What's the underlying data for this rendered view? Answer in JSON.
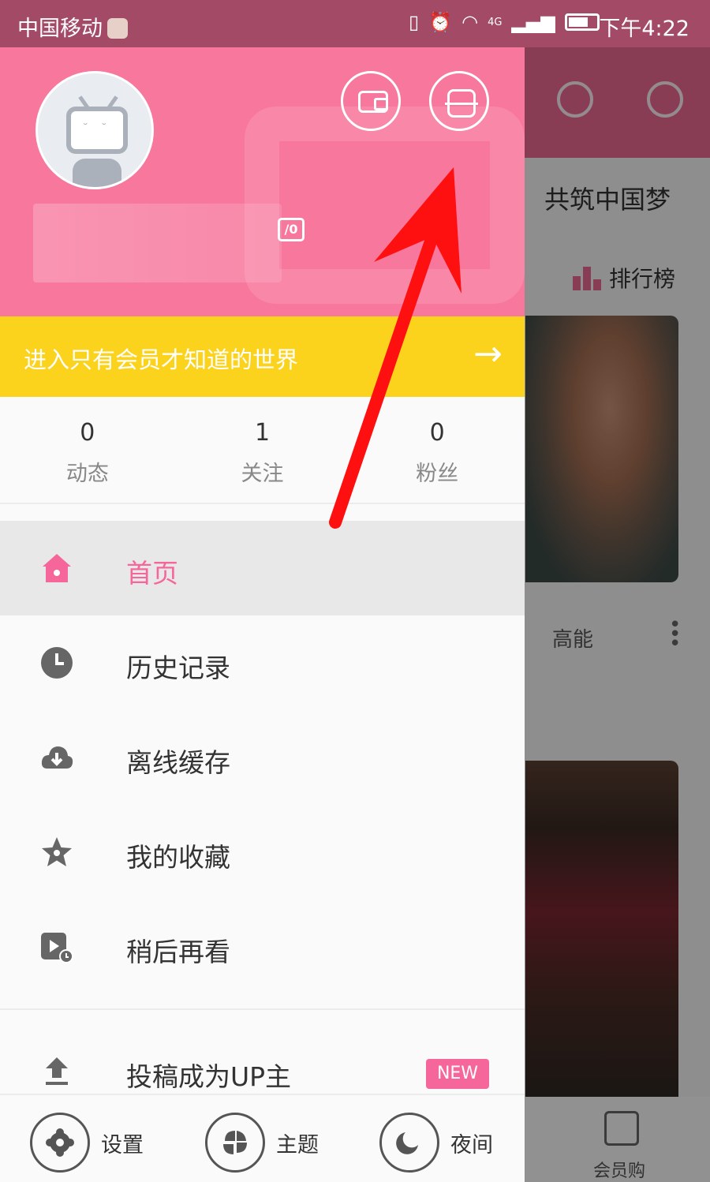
{
  "status_bar": {
    "carrier": "中国移动",
    "network": "4G",
    "time": "下午4:22"
  },
  "background_app": {
    "tab_label": "共筑中国梦",
    "ranking_label": "排行榜",
    "card_tag": "高能",
    "shop_label": "会员购",
    "accent_color": "#ed6a92"
  },
  "drawer": {
    "header": {
      "level_badge": "/0",
      "wallet_icon": "wallet-icon",
      "scan_icon": "scan-icon",
      "color": "#f7779d"
    },
    "vip_banner": {
      "text": "进入只有会员才知道的世界",
      "arrow": "→",
      "color": "#fcd31c"
    },
    "stats": [
      {
        "value": "0",
        "label": "动态"
      },
      {
        "value": "1",
        "label": "关注"
      },
      {
        "value": "0",
        "label": "粉丝"
      }
    ],
    "menu": [
      {
        "label": "首页",
        "icon": "home-icon",
        "active": true
      },
      {
        "label": "历史记录",
        "icon": "clock-icon",
        "active": false
      },
      {
        "label": "离线缓存",
        "icon": "cloud-download-icon",
        "active": false
      },
      {
        "label": "我的收藏",
        "icon": "star-icon",
        "active": false
      },
      {
        "label": "稍后再看",
        "icon": "watch-later-icon",
        "active": false
      }
    ],
    "upload": {
      "label": "投稿成为UP主",
      "badge": "NEW",
      "icon": "upload-icon"
    },
    "bottom": [
      {
        "label": "设置",
        "icon": "gear-icon"
      },
      {
        "label": "主题",
        "icon": "theme-icon"
      },
      {
        "label": "夜间",
        "icon": "moon-icon"
      }
    ]
  },
  "annotation": {
    "arrow_color": "#ff1010"
  }
}
